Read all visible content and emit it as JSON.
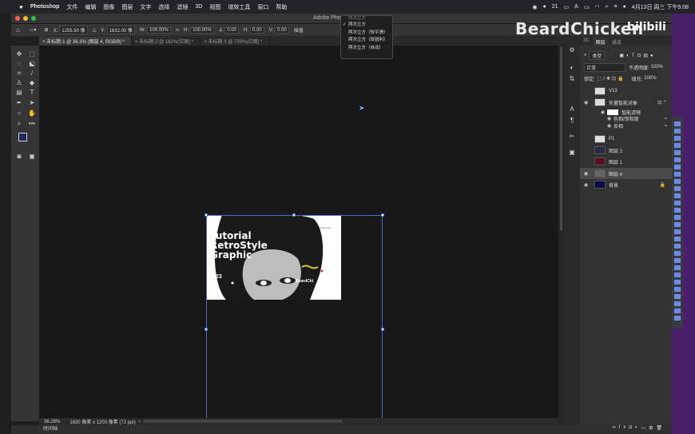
{
  "menubar": {
    "app": "Photoshop",
    "items": [
      "文件",
      "编辑",
      "图像",
      "图层",
      "文字",
      "选择",
      "滤镜",
      "3D",
      "视图",
      "增效工具",
      "窗口",
      "帮助"
    ],
    "battery_count": "21",
    "input_method": "A",
    "clock": "4月13日 周三 下午5:08"
  },
  "window": {
    "title": "Adobe Phot"
  },
  "options": {
    "x_label": "X:",
    "x_value": "1255.50 像",
    "y_label": "Y:",
    "y_value": "1632.00 像",
    "w_label": "W:",
    "w_value": "100.00%",
    "h_label": "H:",
    "h_value": "100.00%",
    "angle_value": "0.00",
    "hskew_label": "H:",
    "hskew_value": "0.00",
    "vskew_label": "V:",
    "vskew_value": "0.00",
    "interp_label": "插值"
  },
  "popup": {
    "items": [
      "两次立方",
      "两次立方",
      "两次立方（较平滑）",
      "两次立方（较锐利）",
      "两次立方（自动）"
    ],
    "checked_index": 1
  },
  "tabs": [
    {
      "label": "未标题-1 @ 36.3% (图层 4, RGB/8) *",
      "active": true
    },
    {
      "label": "未标题-2 @ 182%(位图) *",
      "active": false
    },
    {
      "label": "未标题-3 @ 759%(位图) *",
      "active": false
    }
  ],
  "artwork": {
    "line1": "Tutorial",
    "line2": "RetroStyle",
    "line3": "Graphic",
    "number": "023",
    "brand": "BeardChi",
    "tag": "Good Vibe"
  },
  "status": {
    "zoom": "36.26%",
    "doc_info": "1630 像素 x 1200 像素 (72 ppi)",
    "timeline": "时间轴"
  },
  "layers_panel": {
    "tabs": [
      "3D",
      "图层",
      "通道"
    ],
    "active_tab": "图层",
    "filter_kind": "类型",
    "blend_mode": "正常",
    "opacity_label": "不透明度:",
    "opacity_value": "100%",
    "lock_label": "锁定:",
    "fill_label": "填充:",
    "fill_value": "100%",
    "layers": [
      {
        "name": "V13",
        "visible": false
      },
      {
        "name": "矢量智能对象",
        "visible": true
      },
      {
        "name": "智能滤镜",
        "visible": true,
        "sub": true
      },
      {
        "name": "色相/饱和度",
        "visible": true,
        "sub": true
      },
      {
        "name": "反相",
        "visible": true,
        "sub": true
      },
      {
        "name": "P1",
        "visible": false
      },
      {
        "name": "图层 3",
        "visible": false
      },
      {
        "name": "图层 1",
        "visible": false
      },
      {
        "name": "图层 4",
        "visible": true,
        "selected": true
      },
      {
        "name": "背景",
        "visible": true
      }
    ]
  },
  "watermark": {
    "text": "BeardChicken",
    "logo": "bilibili"
  }
}
